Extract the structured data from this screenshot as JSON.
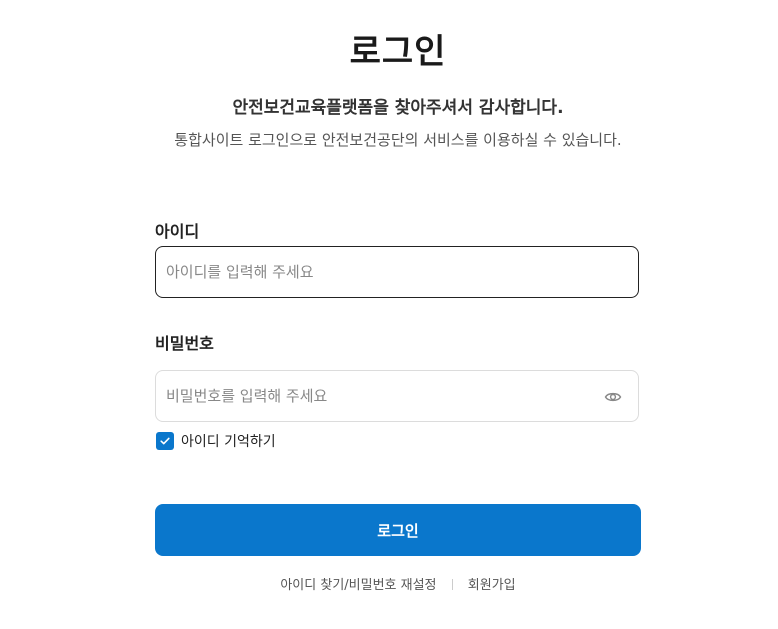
{
  "header": {
    "title": "로그인",
    "subtitle": "안전보건교육플랫폼을 찾아주셔서 감사합니다.",
    "description": "통합사이트 로그인으로 안전보건공단의 서비스를 이용하실 수 있습니다."
  },
  "form": {
    "id_label": "아이디",
    "id_placeholder": "아이디를 입력해 주세요",
    "id_value": "",
    "password_label": "비밀번호",
    "password_placeholder": "비밀번호를 입력해 주세요",
    "password_value": "",
    "password_toggle_icon": "eye-icon",
    "remember_label": "아이디 기억하기",
    "remember_checked": true,
    "submit_label": "로그인"
  },
  "footer_links": {
    "find_account": "아이디 찾기/비밀번호 재설정",
    "signup": "회원가입"
  },
  "colors": {
    "accent": "#0a77cc",
    "text": "#222222",
    "muted": "#555555"
  }
}
